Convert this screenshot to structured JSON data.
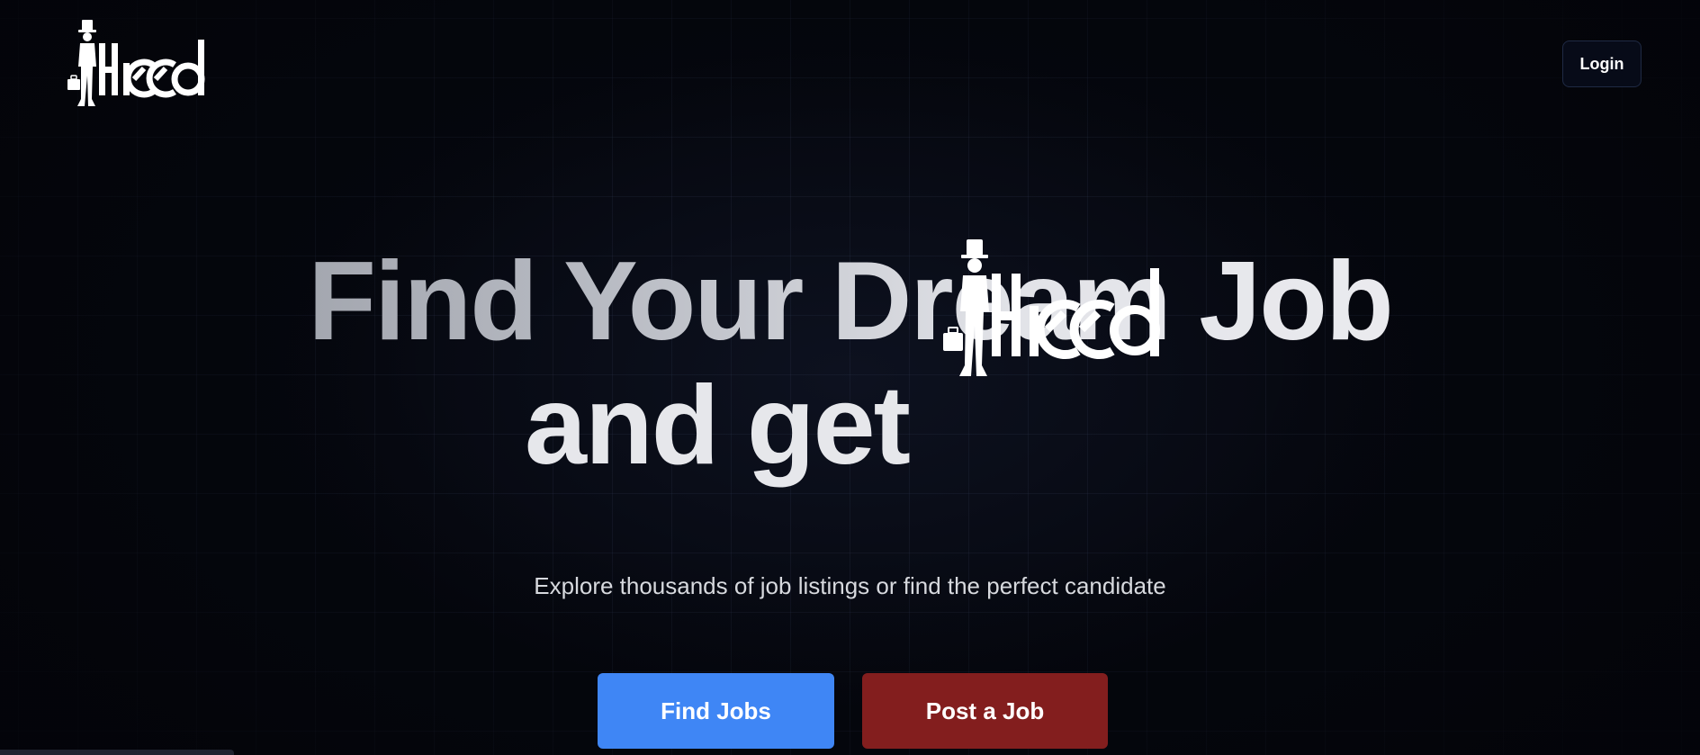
{
  "brand": {
    "name": "Hirrd"
  },
  "header": {
    "login_label": "Login"
  },
  "hero": {
    "headline_line1": "Find Your Dream Job",
    "headline_line2": "and get",
    "subtitle": "Explore thousands of job listings or find the perfect candidate"
  },
  "actions": {
    "find_jobs_label": "Find Jobs",
    "post_job_label": "Post a Job"
  },
  "colors": {
    "background": "#05070e",
    "find_jobs": "#3f86f5",
    "post_job": "#831e1e",
    "text": "#ffffff"
  },
  "icons": {
    "logo": "gentleman-with-top-hat-and-briefcase-logo"
  }
}
